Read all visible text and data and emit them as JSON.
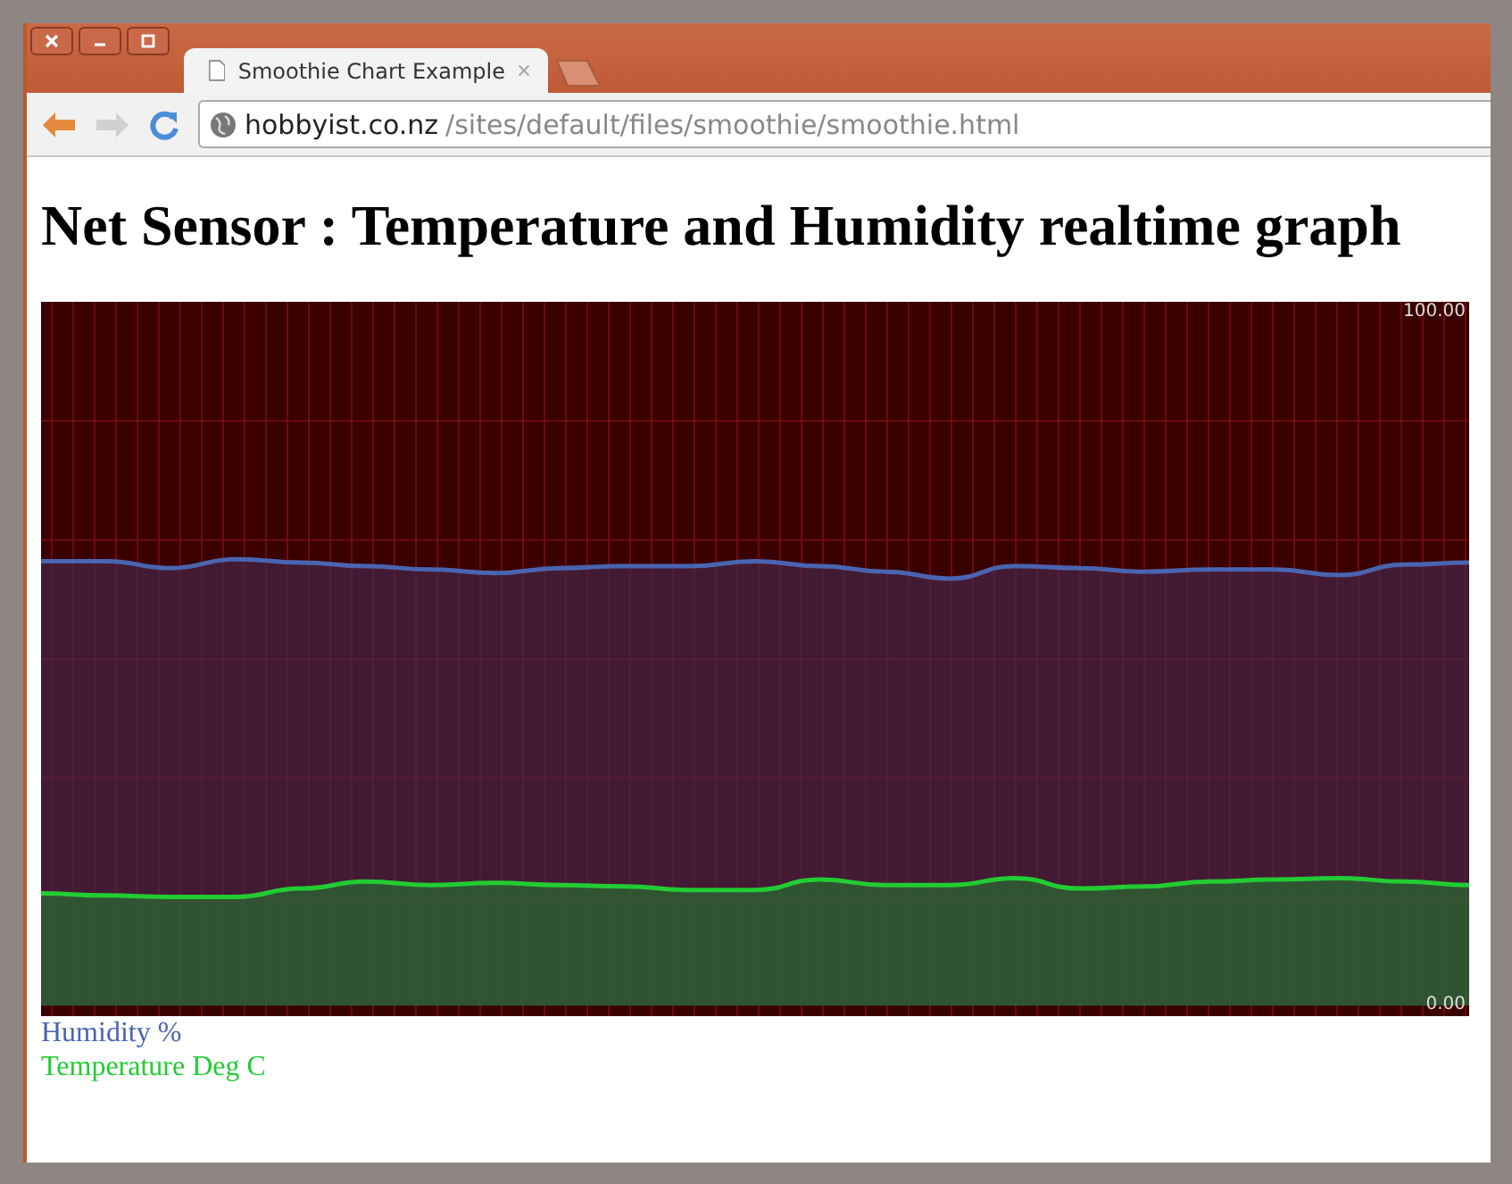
{
  "tabs": [
    {
      "title": "Smoothie Chart Example",
      "selected": true
    }
  ],
  "address_bar": {
    "host": "hobbyist.co.nz",
    "path": "/sites/default/files/smoothie/smoothie.html"
  },
  "page": {
    "heading": "Net Sensor : Temperature and Humidity realtime graph",
    "chart_data": {
      "type": "area",
      "grid": true,
      "ylim": [
        -1.5,
        101.5
      ],
      "yticks": [
        {
          "value": 0,
          "label": "0.00"
        },
        {
          "value": 100,
          "label": "100.00"
        }
      ],
      "series": [
        {
          "name": "Humidity %",
          "color": "#4a64b0",
          "values": [
            64.1,
            64.1,
            63.1,
            64.4,
            63.9,
            63.4,
            62.9,
            62.4,
            63.1,
            63.4,
            63.4,
            64.1,
            63.4,
            62.6,
            61.6,
            63.4,
            63.1,
            62.6,
            62.9,
            62.9,
            62.1,
            63.6,
            63.9
          ]
        },
        {
          "name": "Temperature Deg C",
          "color": "#22cc33",
          "values": [
            16.2,
            15.9,
            15.7,
            15.7,
            16.9,
            17.9,
            17.4,
            17.7,
            17.4,
            17.2,
            16.7,
            16.7,
            18.2,
            17.4,
            17.4,
            18.4,
            16.9,
            17.2,
            17.9,
            18.2,
            18.4,
            17.9,
            17.4
          ]
        }
      ]
    }
  }
}
